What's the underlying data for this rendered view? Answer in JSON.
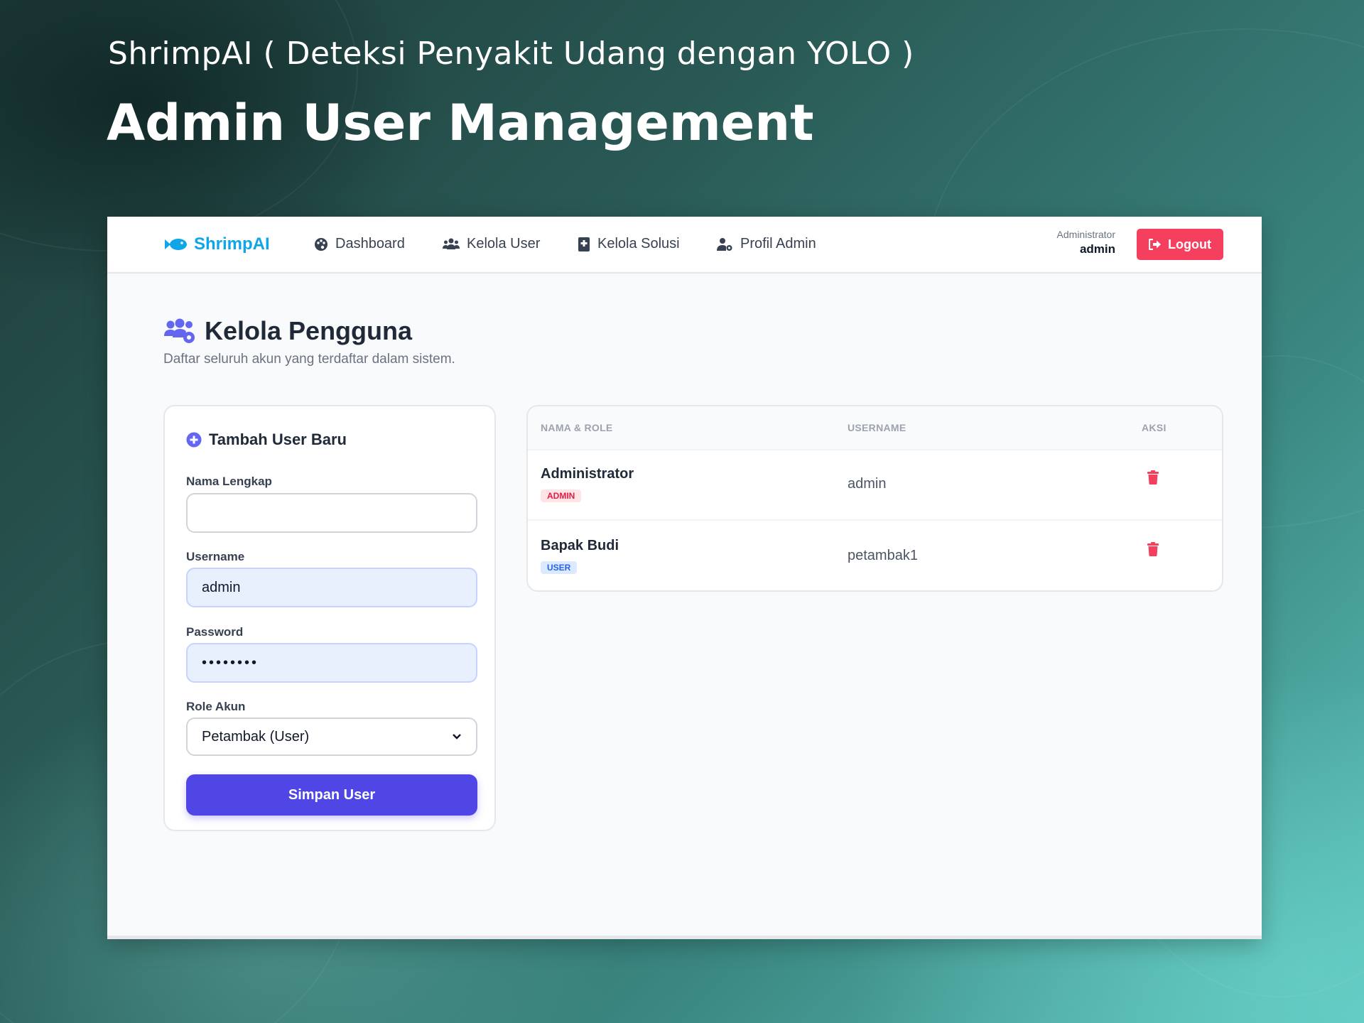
{
  "slide": {
    "subtitle": "ShrimpAI ( Deteksi Penyakit Udang dengan YOLO )",
    "title": "Admin User Management"
  },
  "navbar": {
    "brand": "ShrimpAI",
    "items": [
      {
        "label": "Dashboard",
        "icon": "palette-icon"
      },
      {
        "label": "Kelola User",
        "icon": "users-icon"
      },
      {
        "label": "Kelola Solusi",
        "icon": "book-medical-icon"
      },
      {
        "label": "Profil Admin",
        "icon": "user-cog-icon"
      }
    ],
    "user_role": "Administrator",
    "user_name": "admin",
    "logout_label": "Logout"
  },
  "page": {
    "title": "Kelola Pengguna",
    "description": "Daftar seluruh akun yang terdaftar dalam sistem."
  },
  "form": {
    "title": "Tambah User Baru",
    "name_label": "Nama Lengkap",
    "name_value": "",
    "username_label": "Username",
    "username_value": "admin",
    "password_label": "Password",
    "password_value": "••••••••",
    "role_label": "Role Akun",
    "role_value": "Petambak (User)",
    "submit_label": "Simpan User"
  },
  "table": {
    "headers": [
      "NAMA & ROLE",
      "USERNAME",
      "AKSI"
    ],
    "rows": [
      {
        "name": "Administrator",
        "role": "ADMIN",
        "username": "admin"
      },
      {
        "name": "Bapak Budi",
        "role": "USER",
        "username": "petambak1"
      }
    ]
  },
  "colors": {
    "brand": "#0ea5e9",
    "primary": "#4f46e5",
    "danger": "#f43f5e"
  }
}
